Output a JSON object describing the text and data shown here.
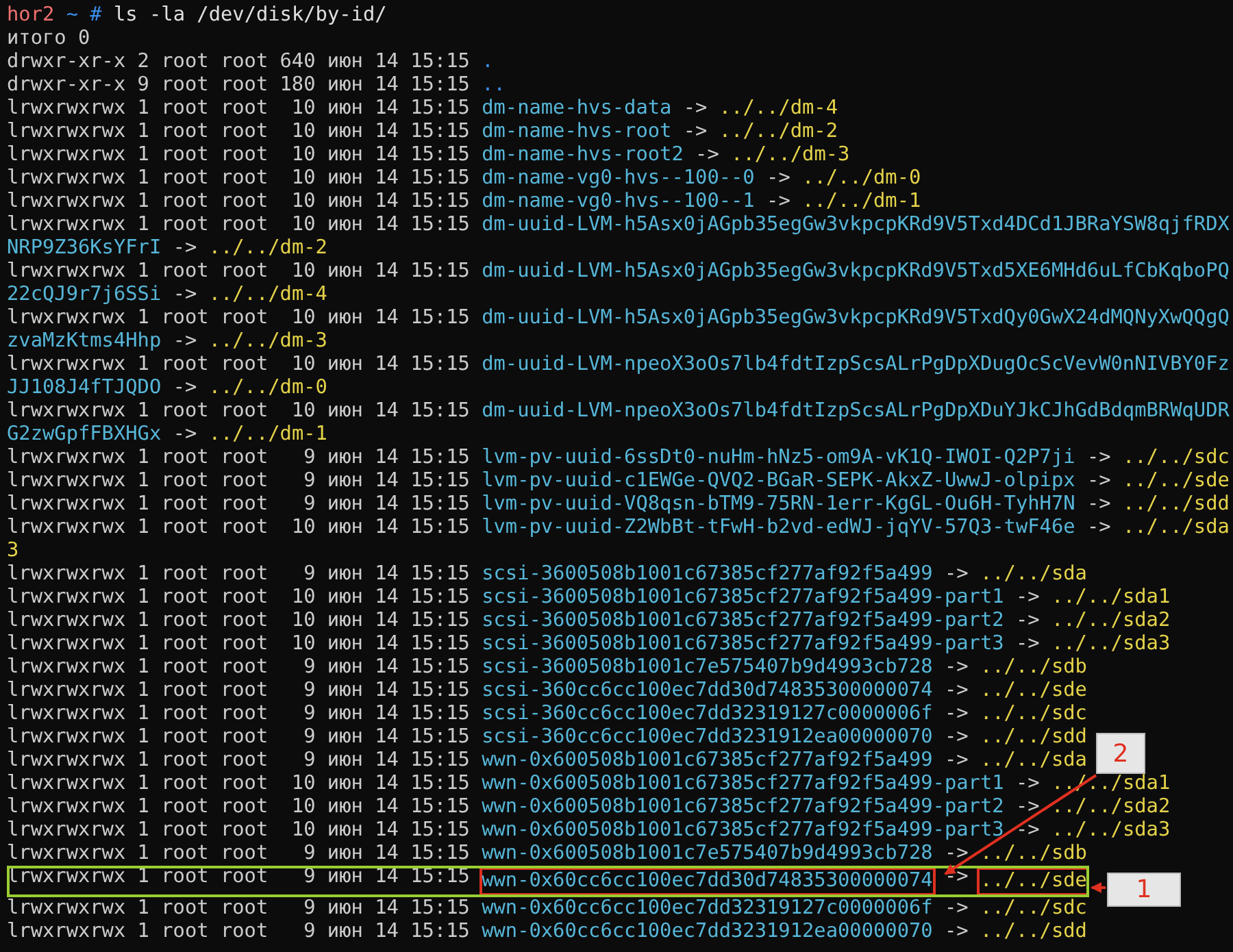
{
  "prompt": {
    "host": "hor2",
    "path": "~",
    "symbol": "#",
    "command": "ls -la /dev/disk/by-id/"
  },
  "total": "итого 0",
  "entries": [
    {
      "kind": "dir",
      "info": "drwxr-xr-x 2 root root 640 июн 14 15:15",
      "name": "."
    },
    {
      "kind": "dir",
      "info": "drwxr-xr-x 9 root root 180 июн 14 15:15",
      "name": ".."
    },
    {
      "kind": "link",
      "info": "lrwxrwxrwx 1 root root  10 июн 14 15:15",
      "name": "dm-name-hvs-data",
      "target": "../../dm-4"
    },
    {
      "kind": "link",
      "info": "lrwxrwxrwx 1 root root  10 июн 14 15:15",
      "name": "dm-name-hvs-root",
      "target": "../../dm-2"
    },
    {
      "kind": "link",
      "info": "lrwxrwxrwx 1 root root  10 июн 14 15:15",
      "name": "dm-name-hvs-root2",
      "target": "../../dm-3"
    },
    {
      "kind": "link",
      "info": "lrwxrwxrwx 1 root root  10 июн 14 15:15",
      "name": "dm-name-vg0-hvs--100--0",
      "target": "../../dm-0"
    },
    {
      "kind": "link",
      "info": "lrwxrwxrwx 1 root root  10 июн 14 15:15",
      "name": "dm-name-vg0-hvs--100--1",
      "target": "../../dm-1"
    },
    {
      "kind": "link",
      "info": "lrwxrwxrwx 1 root root  10 июн 14 15:15",
      "name": "dm-uuid-LVM-h5Asx0jAGpb35egGw3vkpcpKRd9V5Txd4DCd1JBRaYSW8qjfRDXNRP9Z36KsYFrI",
      "target": "../../dm-2"
    },
    {
      "kind": "link",
      "info": "lrwxrwxrwx 1 root root  10 июн 14 15:15",
      "name": "dm-uuid-LVM-h5Asx0jAGpb35egGw3vkpcpKRd9V5Txd5XE6MHd6uLfCbKqboPQ22cQJ9r7j6SSi",
      "target": "../../dm-4"
    },
    {
      "kind": "link",
      "info": "lrwxrwxrwx 1 root root  10 июн 14 15:15",
      "name": "dm-uuid-LVM-h5Asx0jAGpb35egGw3vkpcpKRd9V5TxdQy0GwX24dMQNyXwQQgQzvaMzKtms4Hhp",
      "target": "../../dm-3"
    },
    {
      "kind": "link",
      "info": "lrwxrwxrwx 1 root root  10 июн 14 15:15",
      "name": "dm-uuid-LVM-npeoX3oOs7lb4fdtIzpScsALrPgDpXDugOcScVevW0nNIVBY0FzJJ108J4fTJQDO",
      "target": "../../dm-0"
    },
    {
      "kind": "link",
      "info": "lrwxrwxrwx 1 root root  10 июн 14 15:15",
      "name": "dm-uuid-LVM-npeoX3oOs7lb4fdtIzpScsALrPgDpXDuYJkCJhGdBdqmBRWqUDRG2zwGpfFBXHGx",
      "target": "../../dm-1"
    },
    {
      "kind": "link",
      "info": "lrwxrwxrwx 1 root root   9 июн 14 15:15",
      "name": "lvm-pv-uuid-6ssDt0-nuHm-hNz5-om9A-vK1Q-IWOI-Q2P7ji",
      "target": "../../sdc"
    },
    {
      "kind": "link",
      "info": "lrwxrwxrwx 1 root root   9 июн 14 15:15",
      "name": "lvm-pv-uuid-c1EWGe-QVQ2-BGaR-SEPK-AkxZ-UwwJ-olpipx",
      "target": "../../sde"
    },
    {
      "kind": "link",
      "info": "lrwxrwxrwx 1 root root   9 июн 14 15:15",
      "name": "lvm-pv-uuid-VQ8qsn-bTM9-75RN-1err-KgGL-Ou6H-TyhH7N",
      "target": "../../sdd"
    },
    {
      "kind": "link",
      "info": "lrwxrwxrwx 1 root root  10 июн 14 15:15",
      "name": "lvm-pv-uuid-Z2WbBt-tFwH-b2vd-edWJ-jqYV-57Q3-twF46e",
      "target": "../../sda3"
    },
    {
      "kind": "link",
      "info": "lrwxrwxrwx 1 root root   9 июн 14 15:15",
      "name": "scsi-3600508b1001c67385cf277af92f5a499",
      "target": "../../sda"
    },
    {
      "kind": "link",
      "info": "lrwxrwxrwx 1 root root  10 июн 14 15:15",
      "name": "scsi-3600508b1001c67385cf277af92f5a499-part1",
      "target": "../../sda1"
    },
    {
      "kind": "link",
      "info": "lrwxrwxrwx 1 root root  10 июн 14 15:15",
      "name": "scsi-3600508b1001c67385cf277af92f5a499-part2",
      "target": "../../sda2"
    },
    {
      "kind": "link",
      "info": "lrwxrwxrwx 1 root root  10 июн 14 15:15",
      "name": "scsi-3600508b1001c67385cf277af92f5a499-part3",
      "target": "../../sda3"
    },
    {
      "kind": "link",
      "info": "lrwxrwxrwx 1 root root   9 июн 14 15:15",
      "name": "scsi-3600508b1001c7e575407b9d4993cb728",
      "target": "../../sdb"
    },
    {
      "kind": "link",
      "info": "lrwxrwxrwx 1 root root   9 июн 14 15:15",
      "name": "scsi-360cc6cc100ec7dd30d74835300000074",
      "target": "../../sde"
    },
    {
      "kind": "link",
      "info": "lrwxrwxrwx 1 root root   9 июн 14 15:15",
      "name": "scsi-360cc6cc100ec7dd32319127c0000006f",
      "target": "../../sdc"
    },
    {
      "kind": "link",
      "info": "lrwxrwxrwx 1 root root   9 июн 14 15:15",
      "name": "scsi-360cc6cc100ec7dd3231912ea00000070",
      "target": "../../sdd"
    },
    {
      "kind": "link",
      "info": "lrwxrwxrwx 1 root root   9 июн 14 15:15",
      "name": "wwn-0x600508b1001c67385cf277af92f5a499",
      "target": "../../sda"
    },
    {
      "kind": "link",
      "info": "lrwxrwxrwx 1 root root  10 июн 14 15:15",
      "name": "wwn-0x600508b1001c67385cf277af92f5a499-part1",
      "target": "../../sda1"
    },
    {
      "kind": "link",
      "info": "lrwxrwxrwx 1 root root  10 июн 14 15:15",
      "name": "wwn-0x600508b1001c67385cf277af92f5a499-part2",
      "target": "../../sda2"
    },
    {
      "kind": "link",
      "info": "lrwxrwxrwx 1 root root  10 июн 14 15:15",
      "name": "wwn-0x600508b1001c67385cf277af92f5a499-part3",
      "target": "../../sda3"
    },
    {
      "kind": "link",
      "info": "lrwxrwxrwx 1 root root   9 июн 14 15:15",
      "name": "wwn-0x600508b1001c7e575407b9d4993cb728",
      "target": "../../sdb"
    },
    {
      "kind": "link",
      "info": "lrwxrwxrwx 1 root root   9 июн 14 15:15",
      "name": "wwn-0x60cc6cc100ec7dd30d74835300000074",
      "target": "../../sde",
      "highlight": true,
      "marked": true
    },
    {
      "kind": "link",
      "info": "lrwxrwxrwx 1 root root   9 июн 14 15:15",
      "name": "wwn-0x60cc6cc100ec7dd32319127c0000006f",
      "target": "../../sdc"
    },
    {
      "kind": "link",
      "info": "lrwxrwxrwx 1 root root   9 июн 14 15:15",
      "name": "wwn-0x60cc6cc100ec7dd3231912ea00000070",
      "target": "../../sdd"
    }
  ],
  "arrow_token": "->",
  "callouts": [
    {
      "label": "1"
    },
    {
      "label": "2"
    }
  ]
}
